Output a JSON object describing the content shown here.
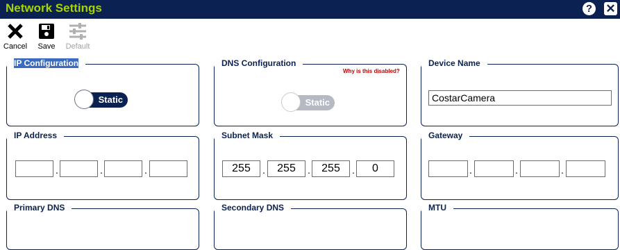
{
  "window": {
    "title": "Network Settings",
    "help_label": "?",
    "close_label": "✕"
  },
  "toolbar": {
    "cancel_label": "Cancel",
    "save_label": "Save",
    "default_label": "Default"
  },
  "ip_configuration": {
    "title": "IP Configuration",
    "mode": "Static"
  },
  "dns_configuration": {
    "title": "DNS Configuration",
    "mode": "Static",
    "disabled_hint": "Why is this disabled?"
  },
  "device_name": {
    "title": "Device Name",
    "value": "CostarCamera"
  },
  "ip_address": {
    "title": "IP Address",
    "octets": [
      "",
      "",
      "",
      ""
    ]
  },
  "subnet_mask": {
    "title": "Subnet Mask",
    "octets": [
      "255",
      "255",
      "255",
      "0"
    ]
  },
  "gateway": {
    "title": "Gateway",
    "octets": [
      "",
      "",
      "",
      ""
    ]
  },
  "primary_dns": {
    "title": "Primary DNS"
  },
  "secondary_dns": {
    "title": "Secondary DNS"
  },
  "mtu": {
    "title": "MTU"
  },
  "colors": {
    "titlebar": "#0b2151",
    "title_text": "#a8d400",
    "accent": "#0b2151",
    "warning": "#c00000"
  }
}
